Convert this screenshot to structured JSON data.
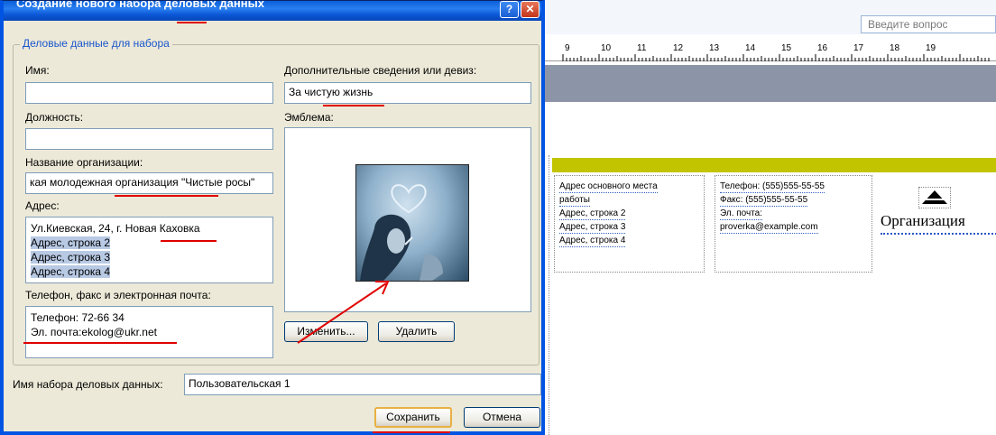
{
  "dialog": {
    "title": "Создание нового набора деловых данных",
    "help_label": "?",
    "close_label": "✕",
    "group_label": "Деловые данные для набора",
    "name": {
      "label": "Имя:",
      "value": ""
    },
    "position": {
      "label": "Должность:",
      "value": ""
    },
    "org": {
      "label": "Название организации:",
      "value": "кая молодежная организация \"Чистые росы\""
    },
    "address": {
      "label": "Адрес:",
      "lines": [
        "Ул.Киевская, 24, г. Новая Каховка",
        "Адрес, строка 2",
        "Адрес, строка 3",
        "Адрес, строка 4"
      ]
    },
    "contacts": {
      "label": "Телефон, факс и электронная почта:",
      "lines": [
        "Телефон: 72-66 34",
        "Эл. почта:ekolog@ukr.net"
      ]
    },
    "motto": {
      "label": "Дополнительные сведения или девиз:",
      "value": "За чистую жизнь"
    },
    "emblem": {
      "label": "Эмблема:"
    },
    "change_button": "Изменить...",
    "delete_button": "Удалить",
    "set_name": {
      "label": "Имя набора деловых данных:",
      "value": "Пользовательская 1"
    },
    "save_button": "Сохранить",
    "cancel_button": "Отмена"
  },
  "publisher": {
    "ask_placeholder": "Введите вопрос",
    "ruler_ticks": [
      "9",
      "10",
      "11",
      "12",
      "13",
      "14",
      "15",
      "16",
      "17",
      "18",
      "19"
    ],
    "address_block": [
      "Адрес основного места",
      "работы",
      "Адрес, строка 2",
      "Адрес, строка 3",
      "Адрес, строка 4"
    ],
    "contact_block": [
      "Телефон: (555)555-55-55",
      "Факс: (555)555-55-55",
      "Эл. почта:",
      "proverka@example.com"
    ],
    "org_text": "Организация"
  },
  "colors": {
    "title_blue": "#0a5fd8",
    "dialog_bg": "#ece9d8",
    "annotation_red": "#e00000",
    "olive_bar": "#c2c400",
    "gray_band": "#8c95a8"
  }
}
